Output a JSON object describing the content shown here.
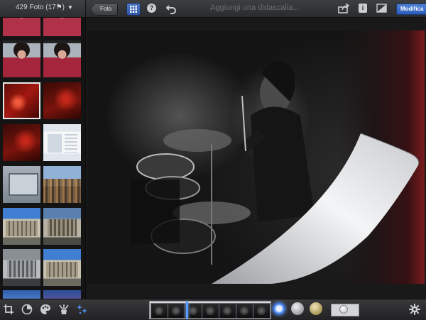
{
  "header": {
    "photos_count": "429 Foto (17⚑)",
    "back_label": "Foto",
    "caption_placeholder": "Aggiungi una didascalia...",
    "edit_label": "Modifica",
    "help_label": "?",
    "info_label": "i"
  },
  "colors": {
    "accent_blue": "#3a6fd0",
    "toolbar_bg": "#2c2d2f",
    "selected_outline": "#e9e9e9"
  },
  "sidebar": {
    "thumbnails": [
      "face-photo",
      "face-photo",
      "face-sunglasses-photo",
      "face-sunglasses-photo",
      "red-stage-photo",
      "red-stage-photo",
      "red-stage-photo",
      "screenshot-photo",
      "device-photo",
      "crowd-photo",
      "building-photo",
      "building-photo",
      "building-bw-photo",
      "building-photo",
      "sky-photo",
      "sunset-photo"
    ],
    "selected_index": 4
  },
  "bottom_toolbar": {
    "tools": [
      "crop-icon",
      "straighten-icon",
      "palette-icon",
      "brush-icon",
      "effects-icon"
    ],
    "active_tool": "effects-icon",
    "effect_presets": [
      "blue-preset",
      "silver-preset",
      "gold-preset"
    ],
    "selected_preset": "blue-preset"
  }
}
